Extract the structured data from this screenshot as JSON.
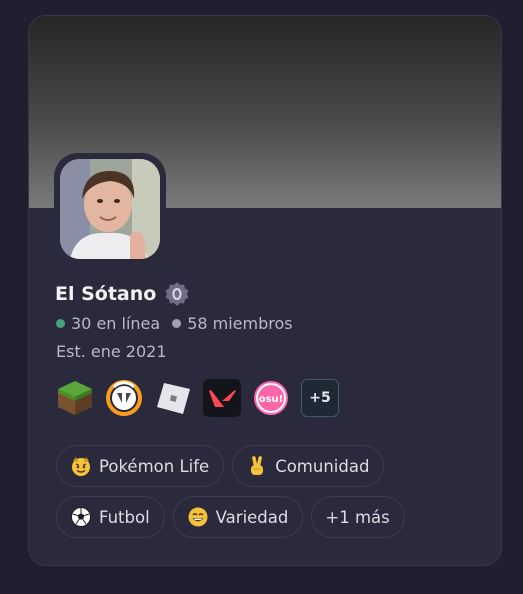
{
  "server": {
    "name": "El Sótano",
    "online": "30 en línea",
    "members": "58 miembros",
    "established": "Est. ene 2021"
  },
  "games": [
    {
      "name": "minecraft-icon"
    },
    {
      "name": "overwatch-icon"
    },
    {
      "name": "roblox-icon"
    },
    {
      "name": "valorant-icon"
    },
    {
      "name": "osu-icon",
      "label": "osu!"
    },
    {
      "name": "more-games",
      "label": "+5"
    }
  ],
  "tags": [
    {
      "emoji": "imp-emoji",
      "label": "Pokémon Life"
    },
    {
      "emoji": "victory-hand-emoji",
      "label": "Comunidad"
    },
    {
      "emoji": "soccer-ball-emoji",
      "label": "Futbol"
    },
    {
      "emoji": "grin-emoji",
      "label": "Variedad"
    },
    {
      "label": "+1 más"
    }
  ],
  "colors": {
    "background": "#201f30",
    "card": "#2b2a3c",
    "online_dot": "#43a57c",
    "member_dot": "#9fa0b0"
  }
}
